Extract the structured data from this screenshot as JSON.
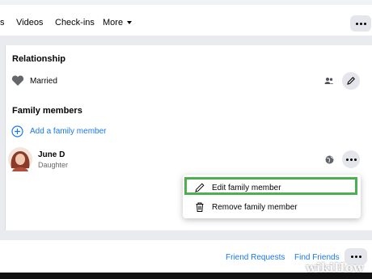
{
  "nav": {
    "tabs": [
      "s",
      "Videos",
      "Check-ins",
      "More"
    ]
  },
  "relationship": {
    "heading": "Relationship",
    "status": "Married"
  },
  "family": {
    "heading": "Family members",
    "add_label": "Add a family member",
    "member": {
      "name": "June D",
      "relation": "Daughter"
    }
  },
  "menu": {
    "edit_label": "Edit family member",
    "remove_label": "Remove family member"
  },
  "bottom": {
    "friend_requests": "Friend Requests",
    "find_friends": "Find Friends"
  },
  "watermark": "wikiHow",
  "colors": {
    "accent": "#1877f2",
    "highlight": "#4caf50"
  }
}
